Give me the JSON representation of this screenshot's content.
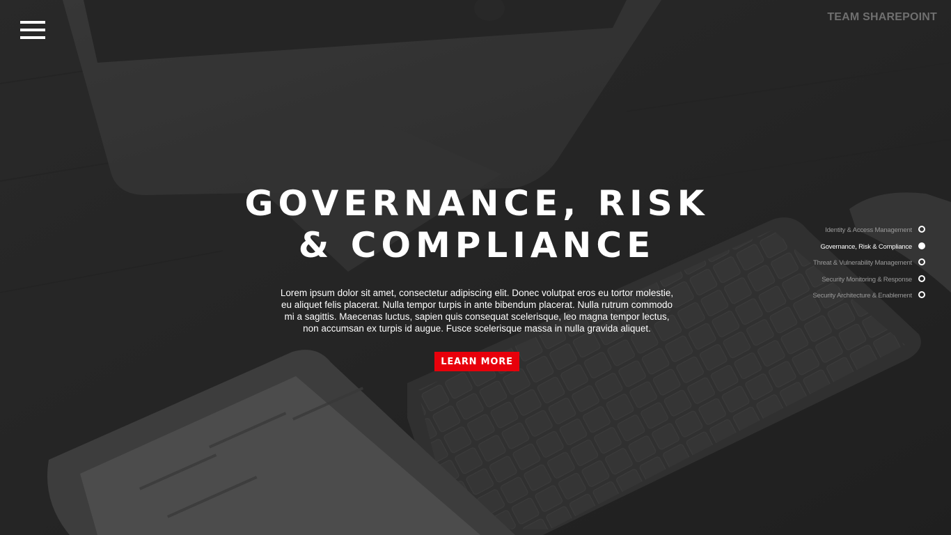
{
  "header": {
    "brand": "TEAM SHAREPOINT",
    "menu_icon": "hamburger-menu-icon"
  },
  "hero": {
    "title_line1": "GOVERNANCE, RISK",
    "title_line2": "& COMPLIANCE",
    "body": "Lorem ipsum dolor sit amet, consectetur adipiscing elit. Donec volutpat eros eu tortor molestie, eu aliquet felis placerat. Nulla tempor turpis in ante bibendum placerat. Nulla rutrum commodo mi a sagittis. Maecenas luctus, sapien quis consequat scelerisque, leo magna tempor lectus, non accumsan ex turpis id augue. Fusce scelerisque massa in nulla gravida aliquet.",
    "cta_label": "LEARN MORE"
  },
  "side_nav": {
    "items": [
      {
        "label": "Identity & Access Management",
        "active": false
      },
      {
        "label": "Governance, Risk & Compliance",
        "active": true
      },
      {
        "label": "Threat & Vulnerability Management",
        "active": false
      },
      {
        "label": "Security Monitoring & Response",
        "active": false
      },
      {
        "label": "Security Architecture & Enablement",
        "active": false
      }
    ]
  },
  "colors": {
    "accent": "#e8000b",
    "text": "#ffffff",
    "muted": "#9a9a9a",
    "brand": "#6f6f6f"
  }
}
